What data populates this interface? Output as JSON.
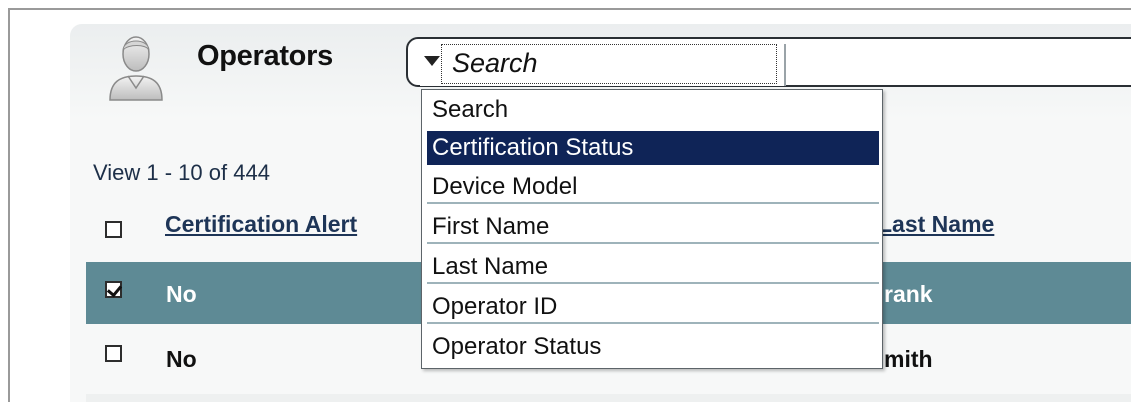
{
  "header": {
    "title": "Operators",
    "avatar_icon": "user-avatar-icon"
  },
  "search": {
    "selected_field": "Search",
    "options": [
      "Search",
      "Certification Status",
      "Device Model",
      "First Name",
      "Last Name",
      "Operator ID",
      "Operator Status"
    ],
    "highlighted_option": "Certification Status"
  },
  "grid": {
    "view_count": "View 1 - 10 of 444",
    "columns": [
      "Certification Alert",
      "Last Name"
    ],
    "rows": [
      {
        "checked": true,
        "certification_alert": "No",
        "last_name": "rank"
      },
      {
        "checked": false,
        "certification_alert": "No",
        "last_name": "mith"
      }
    ]
  },
  "colors": {
    "selected_row": "#5e8a95",
    "highlight_option": "#0f2457",
    "header_link": "#1e3557"
  }
}
